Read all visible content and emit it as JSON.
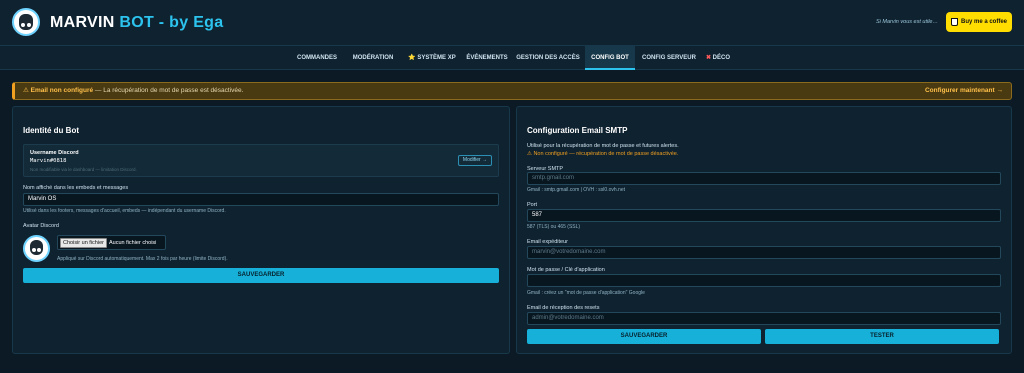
{
  "header": {
    "brand_main": "MARVIN ",
    "brand_accent": "BOT",
    "brand_suffix": " - by Ega",
    "support_text": "Si Marvin vous est utile…",
    "coffee_label": "Buy me a coffee",
    "logo_icon": "robot-avatar-icon",
    "coffee_icon": "coffee-cup-icon"
  },
  "nav": {
    "items": [
      {
        "label": "COMMANDES"
      },
      {
        "label": "MODÉRATION"
      },
      {
        "label": "⭐ SYSTÈME XP"
      },
      {
        "label": "ÉVÉNEMENTS"
      },
      {
        "label": "GESTION DES ACCÈS"
      },
      {
        "label": "CONFIG BOT",
        "active": true
      },
      {
        "label": "CONFIG SERVEUR"
      },
      {
        "label": "DÉCO",
        "prefix": "✖"
      }
    ]
  },
  "warning": {
    "icon": "⚠",
    "title": "Email non configuré",
    "message": " — La récupération de mot de passe est désactivée.",
    "action": "Configurer maintenant →",
    "accent_color": "#f0a020"
  },
  "identity": {
    "title": "Identité du Bot",
    "username_label": "Username Discord",
    "username_value": "Marvin#0818",
    "username_hint": "Non modifiable via le dashboard — limitation Discord.",
    "modify_label": "Modifier →",
    "display_name_label": "Nom affiché dans les embeds et messages",
    "display_name_value": "Marvin OS",
    "display_name_hint": "Utilisé dans les footers, messages d'accueil, embeds — indépendant du username Discord.",
    "avatar_label": "Avatar Discord",
    "file_button": "Choisir un fichier",
    "file_status": "Aucun fichier choisi",
    "avatar_hint": "Appliqué sur Discord automatiquement. Max 2 fois par heure (limite Discord).",
    "save_label": "SAUVEGARDER"
  },
  "smtp": {
    "title": "Configuration Email SMTP",
    "desc": "Utilisé pour la récupération de mot de passe et futures alertes.",
    "status": "⚠ Non configuré — récupération de mot de passe désactivée.",
    "server_label": "Serveur SMTP",
    "server_placeholder": "smtp.gmail.com",
    "server_hint": "Gmail : smtp.gmail.com | OVH : ssl0.ovh.net",
    "port_label": "Port",
    "port_value": "587",
    "port_hint": "587 (TLS) ou 465 (SSL)",
    "from_label": "Email expéditeur",
    "from_placeholder": "marvin@votredomaine.com",
    "password_label": "Mot de passe / Clé d'application",
    "password_placeholder": "",
    "password_hint": "Gmail : créez un \"mot de passe d'application\" Google",
    "reset_label": "Email de réception des resets",
    "reset_placeholder": "admin@votredomaine.com",
    "save_label": "SAUVEGARDER",
    "test_label": "TESTER",
    "button_color": "#17b0d8"
  }
}
